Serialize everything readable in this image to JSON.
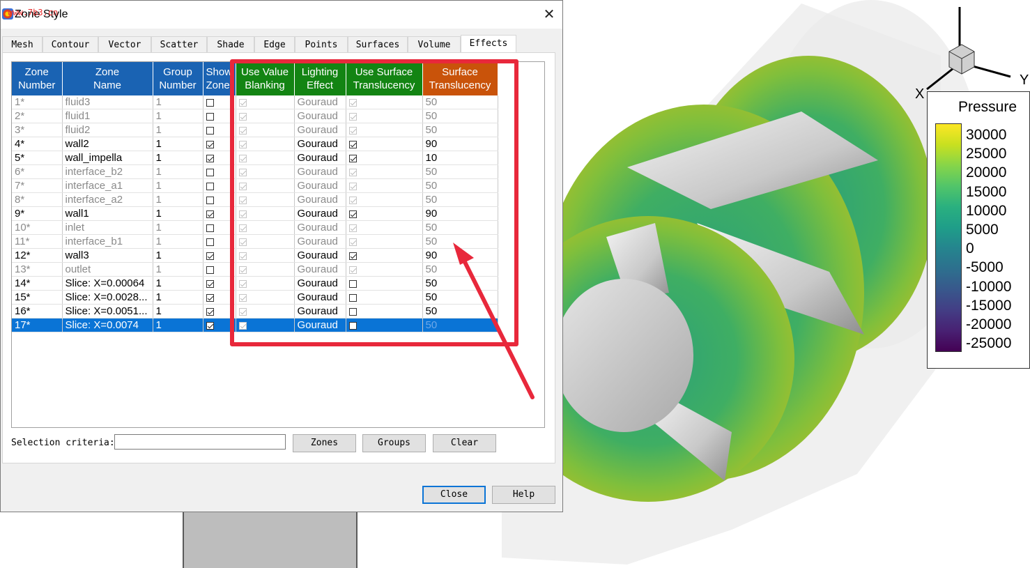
{
  "window": {
    "title": "Zone Style",
    "watermark": "www.7b3.cn",
    "close_glyph": "✕"
  },
  "tabs": [
    {
      "label": "Mesh"
    },
    {
      "label": "Contour"
    },
    {
      "label": "Vector"
    },
    {
      "label": "Scatter"
    },
    {
      "label": "Shade"
    },
    {
      "label": "Edge"
    },
    {
      "label": "Points"
    },
    {
      "label": "Surfaces"
    },
    {
      "label": "Volume"
    },
    {
      "label": "Effects",
      "active": true
    }
  ],
  "table": {
    "headers": {
      "zone_number": [
        "Zone",
        "Number"
      ],
      "zone_name": [
        "Zone",
        "Name"
      ],
      "group_number": [
        "Group",
        "Number"
      ],
      "show_zone": [
        "Show",
        "Zone"
      ],
      "value_blanking": [
        "Use Value",
        "Blanking"
      ],
      "lighting": [
        "Lighting",
        "Effect"
      ],
      "use_translucency": [
        "Use Surface",
        "Translucency"
      ],
      "translucency": [
        "Surface",
        "Translucency"
      ]
    },
    "rows": [
      {
        "num": "1*",
        "name": "fluid3",
        "group": "1",
        "show": false,
        "active": false,
        "blank": true,
        "light": "Gouraud",
        "use_tr": true,
        "tr": "50"
      },
      {
        "num": "2*",
        "name": "fluid1",
        "group": "1",
        "show": false,
        "active": false,
        "blank": true,
        "light": "Gouraud",
        "use_tr": true,
        "tr": "50"
      },
      {
        "num": "3*",
        "name": "fluid2",
        "group": "1",
        "show": false,
        "active": false,
        "blank": true,
        "light": "Gouraud",
        "use_tr": true,
        "tr": "50"
      },
      {
        "num": "4*",
        "name": "wall2",
        "group": "1",
        "show": true,
        "active": true,
        "blank": true,
        "light": "Gouraud",
        "use_tr": true,
        "tr": "90"
      },
      {
        "num": "5*",
        "name": "wall_impella",
        "group": "1",
        "show": true,
        "active": true,
        "blank": true,
        "light": "Gouraud",
        "use_tr": true,
        "tr": "10"
      },
      {
        "num": "6*",
        "name": "interface_b2",
        "group": "1",
        "show": false,
        "active": false,
        "blank": true,
        "light": "Gouraud",
        "use_tr": true,
        "tr": "50"
      },
      {
        "num": "7*",
        "name": "interface_a1",
        "group": "1",
        "show": false,
        "active": false,
        "blank": true,
        "light": "Gouraud",
        "use_tr": true,
        "tr": "50"
      },
      {
        "num": "8*",
        "name": "interface_a2",
        "group": "1",
        "show": false,
        "active": false,
        "blank": true,
        "light": "Gouraud",
        "use_tr": true,
        "tr": "50"
      },
      {
        "num": "9*",
        "name": "wall1",
        "group": "1",
        "show": true,
        "active": true,
        "blank": true,
        "light": "Gouraud",
        "use_tr": true,
        "tr": "90"
      },
      {
        "num": "10*",
        "name": "inlet",
        "group": "1",
        "show": false,
        "active": false,
        "blank": true,
        "light": "Gouraud",
        "use_tr": true,
        "tr": "50"
      },
      {
        "num": "11*",
        "name": "interface_b1",
        "group": "1",
        "show": false,
        "active": false,
        "blank": true,
        "light": "Gouraud",
        "use_tr": true,
        "tr": "50"
      },
      {
        "num": "12*",
        "name": "wall3",
        "group": "1",
        "show": true,
        "active": true,
        "blank": true,
        "light": "Gouraud",
        "use_tr": true,
        "tr": "90"
      },
      {
        "num": "13*",
        "name": "outlet",
        "group": "1",
        "show": false,
        "active": false,
        "blank": true,
        "light": "Gouraud",
        "use_tr": true,
        "tr": "50"
      },
      {
        "num": "14*",
        "name": "Slice: X=0.00064",
        "group": "1",
        "show": true,
        "active": true,
        "blank": true,
        "light": "Gouraud",
        "use_tr": false,
        "tr": "50"
      },
      {
        "num": "15*",
        "name": "Slice: X=0.0028...",
        "group": "1",
        "show": true,
        "active": true,
        "blank": true,
        "light": "Gouraud",
        "use_tr": false,
        "tr": "50"
      },
      {
        "num": "16*",
        "name": "Slice: X=0.0051...",
        "group": "1",
        "show": true,
        "active": true,
        "blank": true,
        "light": "Gouraud",
        "use_tr": false,
        "tr": "50"
      },
      {
        "num": "17*",
        "name": "Slice: X=0.0074",
        "group": "1",
        "show": true,
        "active": true,
        "blank": true,
        "light": "Gouraud",
        "use_tr": false,
        "tr": "50",
        "selected": true
      }
    ]
  },
  "selection": {
    "label": "Selection criteria:",
    "value": "",
    "zones": "Zones",
    "groups": "Groups",
    "clear": "Clear"
  },
  "footer": {
    "close": "Close",
    "help": "Help"
  },
  "legend": {
    "title": "Pressure",
    "levels": [
      "30000",
      "25000",
      "20000",
      "15000",
      "10000",
      "5000",
      "0",
      "-5000",
      "-10000",
      "-15000",
      "-20000",
      "-25000"
    ],
    "colors": [
      "#fde725",
      "#c8e020",
      "#86d549",
      "#52c569",
      "#2ab07f",
      "#1f9e89",
      "#25858e",
      "#2d708e",
      "#38588c",
      "#433e85",
      "#482173",
      "#440154"
    ]
  },
  "axes": {
    "x": "X",
    "y": "Y"
  },
  "colors": {
    "header_blue": "#1a63b3",
    "header_green": "#138413",
    "header_orange": "#c9530a",
    "selection": "#0a74d6",
    "annotation": "#e8283b"
  }
}
